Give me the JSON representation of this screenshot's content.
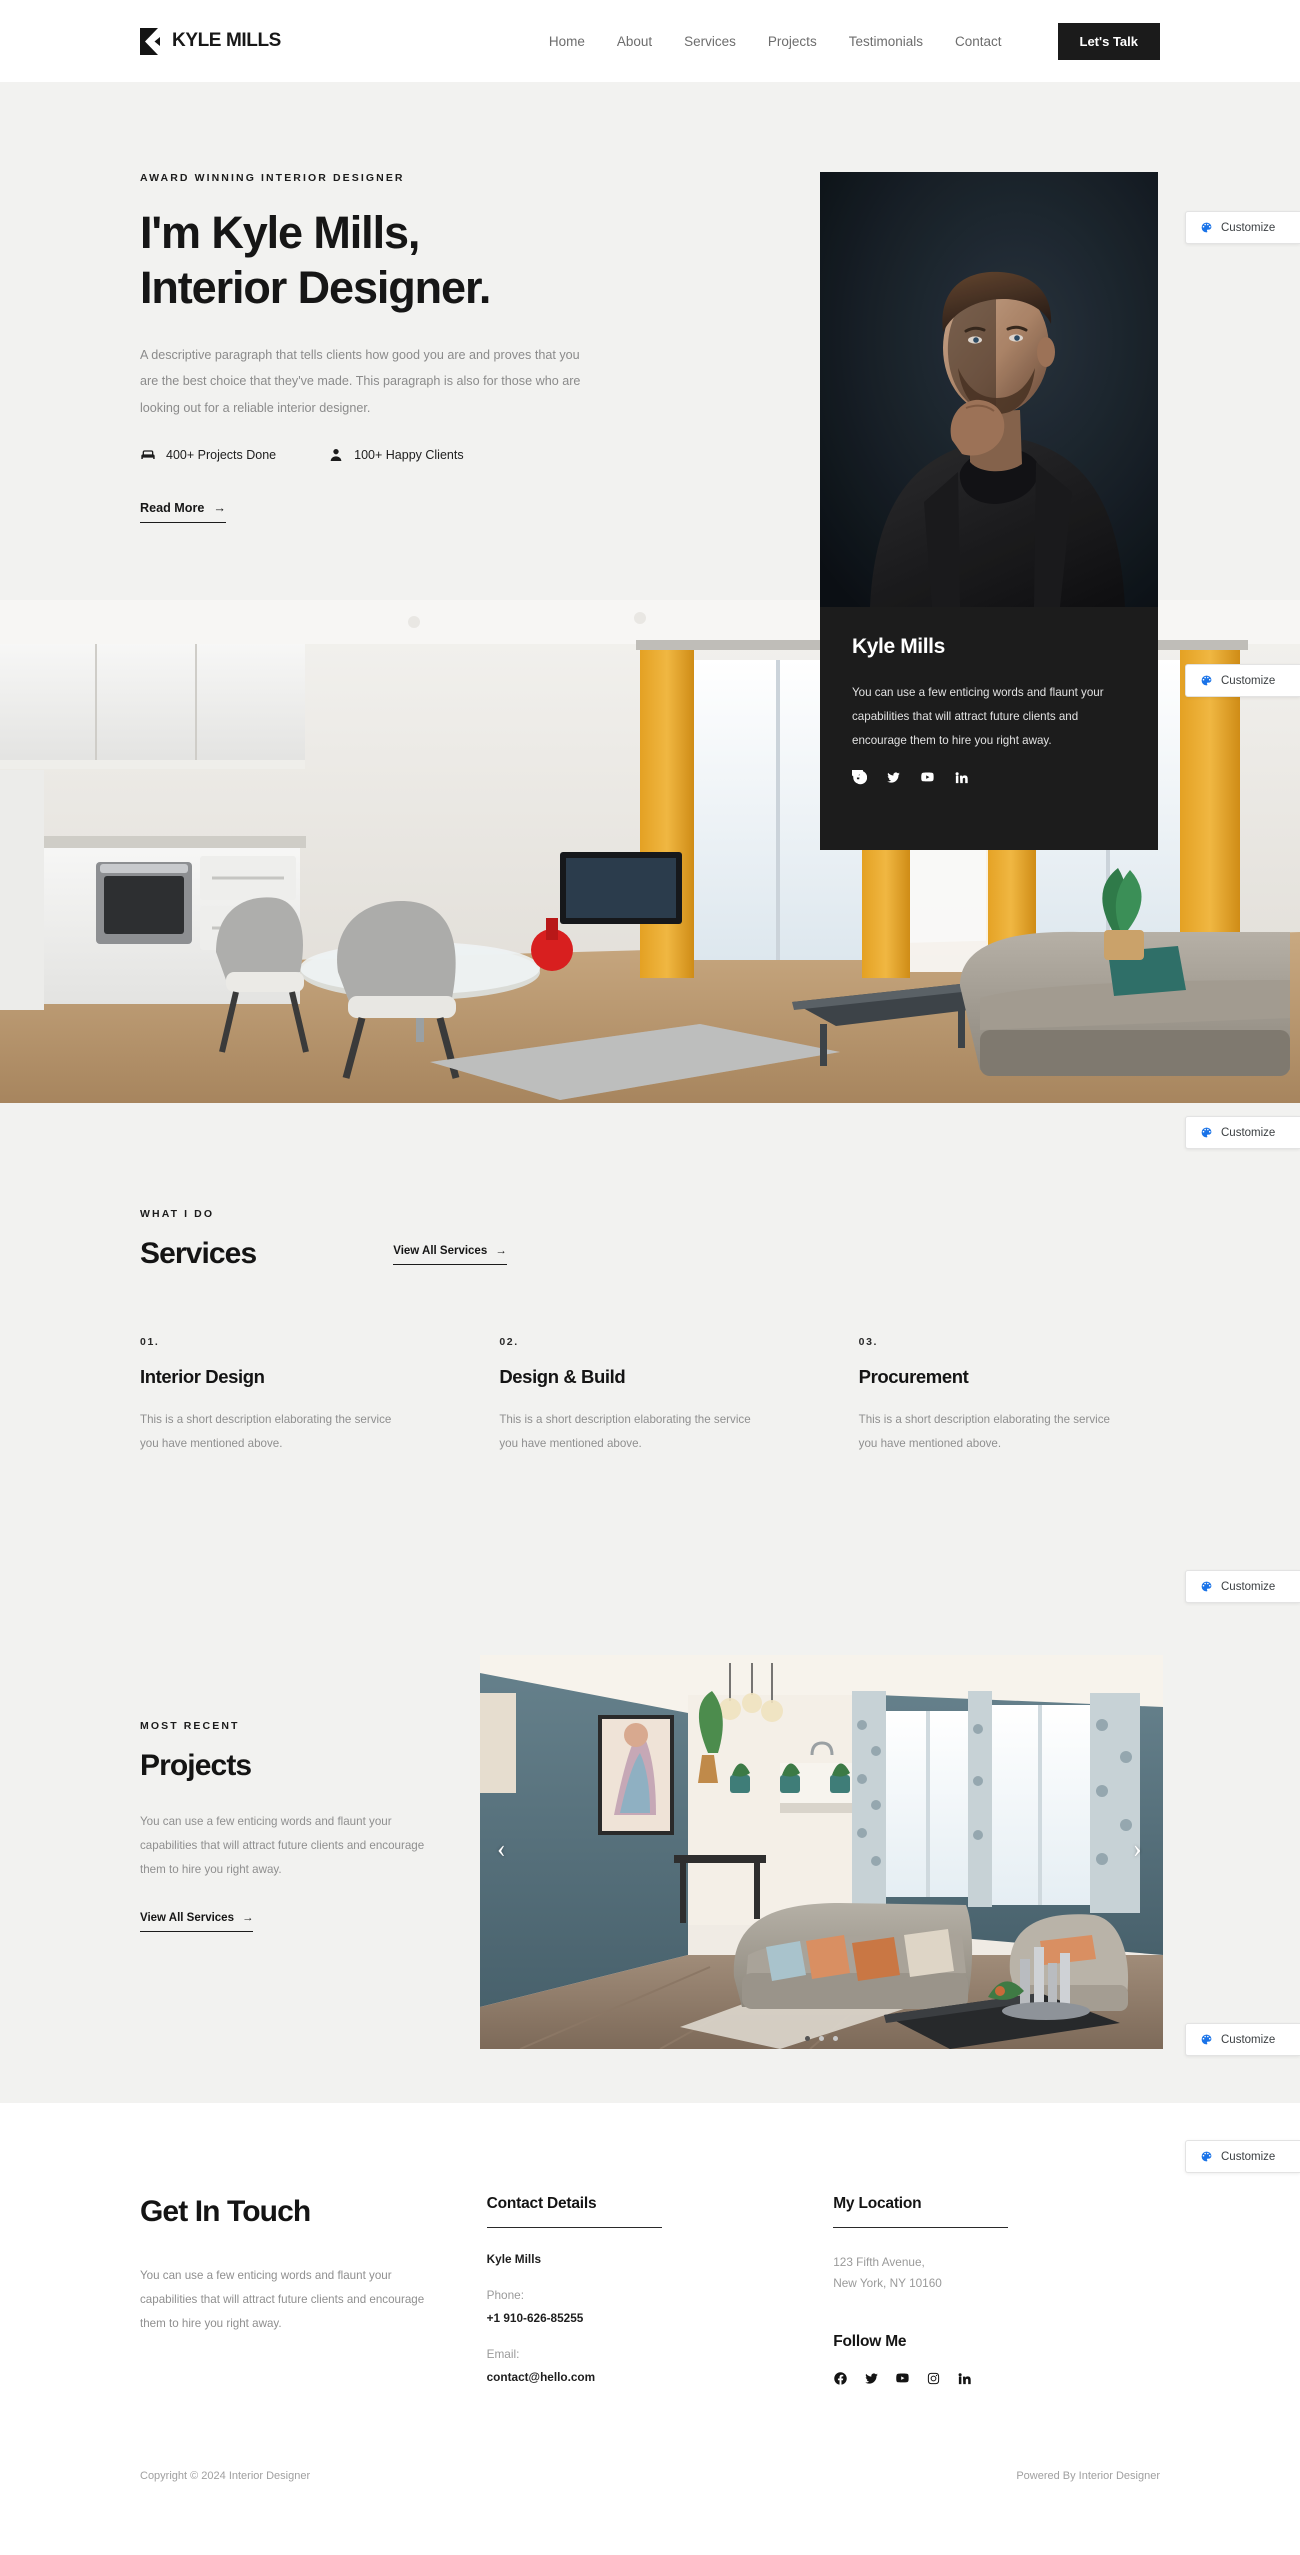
{
  "header": {
    "brand": "KYLE MILLS",
    "nav": [
      {
        "label": "Home"
      },
      {
        "label": "About"
      },
      {
        "label": "Services"
      },
      {
        "label": "Projects"
      },
      {
        "label": "Testimonials"
      },
      {
        "label": "Contact"
      }
    ],
    "cta": "Let's Talk"
  },
  "hero": {
    "eyebrow": "AWARD WINNING INTERIOR DESIGNER",
    "title_line1": "I'm Kyle Mills,",
    "title_line2": "Interior Designer.",
    "description": "A descriptive paragraph that tells clients how good you are and proves that you are the best choice that they've made. This paragraph is also for those who are looking out for a reliable interior designer.",
    "stats": [
      {
        "icon": "sofa-icon",
        "label": "400+ Projects Done"
      },
      {
        "icon": "person-icon",
        "label": "100+ Happy Clients"
      }
    ],
    "read_more": "Read More",
    "arrow": "→"
  },
  "bio_card": {
    "name": "Kyle Mills",
    "text": "You can use a few enticing words and flaunt your capabilities that will attract future clients and encourage them to hire you right away.",
    "socials": [
      "facebook-icon",
      "twitter-icon",
      "youtube-icon",
      "linkedin-icon"
    ]
  },
  "services": {
    "eyebrow": "WHAT I DO",
    "title": "Services",
    "view_all": "View All Services",
    "arrow": "→",
    "items": [
      {
        "num": "01.",
        "name": "Interior Design",
        "desc": "This is a short description elaborating the service you have mentioned above."
      },
      {
        "num": "02.",
        "name": "Design & Build",
        "desc": "This is a short description elaborating the service you have mentioned above."
      },
      {
        "num": "03.",
        "name": "Procurement",
        "desc": "This is a short description elaborating the service you have mentioned above."
      }
    ]
  },
  "projects": {
    "eyebrow": "MOST RECENT",
    "title": "Projects",
    "description": "You can use a few enticing words and flaunt your capabilities that will attract future clients and encourage them to hire you right away.",
    "view_all": "View All Services",
    "arrow": "→",
    "prev": "‹",
    "next": "›",
    "slides": 3,
    "active_slide": 1
  },
  "contact": {
    "title": "Get In Touch",
    "description": "You can use a few enticing words and flaunt your capabilities that will attract future clients and encourage them to hire you right away.",
    "details_head": "Contact Details",
    "details_name": "Kyle Mills",
    "phone_label": "Phone:",
    "phone_value": "+1 910-626-85255",
    "email_label": "Email:",
    "email_value": "contact@hello.com",
    "location_head": "My Location",
    "address_line1": "123 Fifth Avenue,",
    "address_line2": "New York, NY 10160",
    "follow_head": "Follow Me",
    "follow_socials": [
      "facebook-icon",
      "twitter-icon",
      "youtube-icon",
      "instagram-icon",
      "linkedin-icon"
    ]
  },
  "footer": {
    "copyright": "Copyright © 2024 Interior Designer",
    "powered": "Powered By Interior Designer"
  },
  "customize": {
    "label": "Customize",
    "icon": "palette-icon",
    "accent": "#1a73e8"
  },
  "colors": {
    "bg_light": "#f2f2f0",
    "dark": "#1c1c1c",
    "muted": "#8f8f8f"
  }
}
